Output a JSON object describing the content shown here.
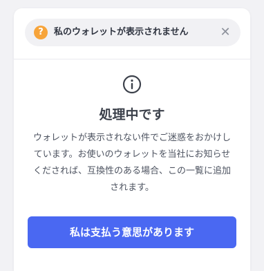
{
  "header": {
    "help_icon": "question-circle-icon",
    "help_glyph": "?",
    "title": "私のウォレットが表示されません",
    "close_icon": "close-icon",
    "close_glyph": "✕"
  },
  "status": {
    "icon": "info-icon",
    "title": "処理中です",
    "message": "ウォレットが表示されない件でご迷惑をおかけしています。お使いのウォレットを当社にお知らせくだされば、互換性のある場合、この一覧に追加されます。"
  },
  "actions": {
    "confirm_label": "私は支払う意思があります"
  },
  "colors": {
    "accent": "#4a68f2",
    "warning": "#f7a43a",
    "background": "#f2f2f5",
    "pill": "#f1f1f4"
  }
}
